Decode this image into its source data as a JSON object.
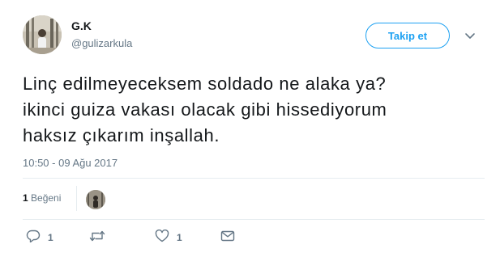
{
  "author": {
    "name": "G.K",
    "handle": "@gulizarkula"
  },
  "follow_button": {
    "label": "Takip et"
  },
  "tweet": {
    "text": "Linç edilmeyeceksem soldado ne alaka ya?\nikinci guiza vakası olacak gibi hissediyorum\nhaksız çıkarım inşallah.",
    "timestamp": "10:50 - 09 Ağu 2017"
  },
  "stats": {
    "likes_count": "1",
    "likes_label": "Beğeni"
  },
  "actions": {
    "reply_count": "1",
    "retweet_count": "",
    "like_count": "1"
  },
  "icons": {
    "reply": "reply-icon",
    "retweet": "retweet-icon",
    "like": "heart-icon",
    "dm": "envelope-icon",
    "menu": "chevron-down-icon"
  },
  "colors": {
    "accent": "#1da1f2",
    "muted": "#657786",
    "text": "#14171a",
    "divider": "#e6ecf0"
  }
}
